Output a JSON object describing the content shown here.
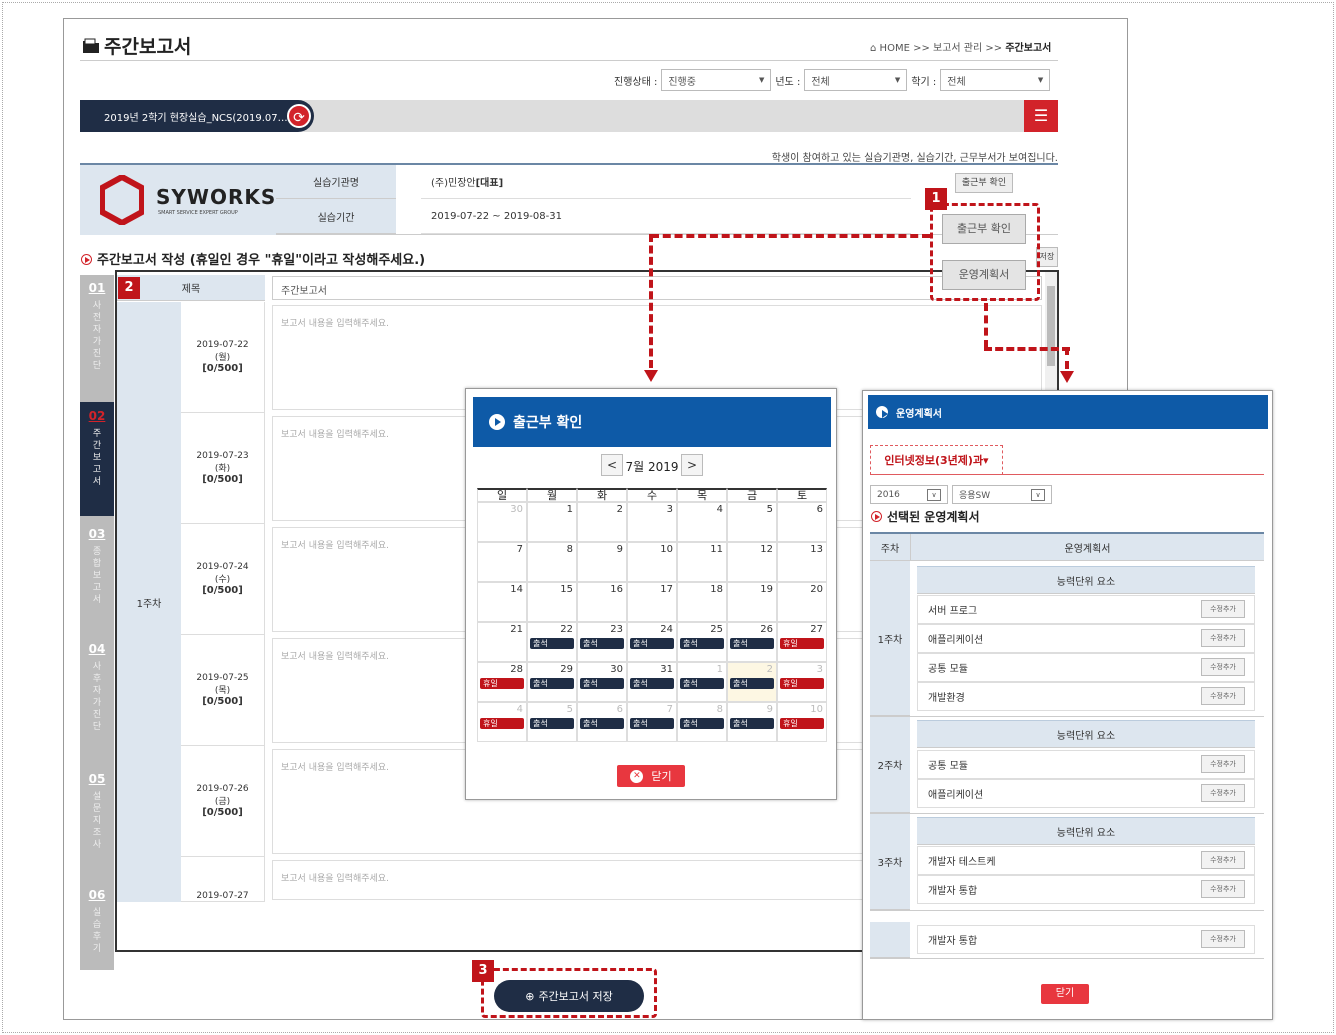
{
  "header": {
    "title": "주간보고서",
    "home": "HOME",
    "sep": ">>",
    "crumb_mid": "보고서 관리",
    "crumb_last": "주간보고서"
  },
  "filters": {
    "status_label": "진행상태 :",
    "status_value": "진행중",
    "year_label": "년도 :",
    "year_value": "전체",
    "term_label": "학기 :",
    "term_value": "전체",
    "arrow": "▼"
  },
  "course_bar": {
    "course": "2019년 2학기 현장실습_NCS(2019.07…",
    "refresh_icon": "⟳",
    "menu_icon": "☰"
  },
  "notice": "학생이 참여하고 있는 실습기관명, 실습기간, 근무부서가 보여집니다.",
  "company": {
    "logo_name": "SYWORKS",
    "logo_sub": "SMART SERVICE EXPERT GROUP",
    "org_label": "실습기관명",
    "org_value": "(주)민장안",
    "org_tag": "[대표]",
    "period_label": "실습기간",
    "period_value": "2019-07-22 ~ 2019-08-31",
    "attendance_small": "출근부 확인"
  },
  "section_title": "주간보고서 작성 (휴일인 경우 \"휴일\"이라고 작성해주세요.)",
  "save_partial": "저장",
  "side_nav": [
    {
      "num": "01",
      "label": "사전자가진단"
    },
    {
      "num": "02",
      "label": "주간보고서"
    },
    {
      "num": "03",
      "label": "종합보고서"
    },
    {
      "num": "04",
      "label": "사후자가진단"
    },
    {
      "num": "05",
      "label": "설문지조사"
    },
    {
      "num": "06",
      "label": "실습후기"
    }
  ],
  "form": {
    "subject_label": "제목",
    "subject_value": "주간보고서",
    "week_label": "1주차",
    "placeholder": "보고서 내용을 입력해주세요.",
    "days": [
      {
        "date": "2019-07-22",
        "dow": "(월)",
        "count": "[0/500]"
      },
      {
        "date": "2019-07-23",
        "dow": "(화)",
        "count": "[0/500]"
      },
      {
        "date": "2019-07-24",
        "dow": "(수)",
        "count": "[0/500]"
      },
      {
        "date": "2019-07-25",
        "dow": "(목)",
        "count": "[0/500]"
      },
      {
        "date": "2019-07-26",
        "dow": "(금)",
        "count": "[0/500]"
      },
      {
        "date": "2019-07-27",
        "dow": "",
        "count": ""
      }
    ]
  },
  "callouts": {
    "b1": "1",
    "b2": "2",
    "b3": "3",
    "attendance_btn": "출근부 확인",
    "plan_btn": "운영계획서"
  },
  "save_button": "주간보고서 저장",
  "attendance_popup": {
    "title": "출근부 확인",
    "month": "7월 2019",
    "prev": "<",
    "next": ">",
    "weekdays": [
      "일",
      "월",
      "화",
      "수",
      "목",
      "금",
      "토"
    ],
    "att": "출석",
    "off": "휴일",
    "weeks": [
      [
        [
          "30",
          "m",
          ""
        ],
        [
          "1",
          "",
          ""
        ],
        [
          "2",
          "",
          ""
        ],
        [
          "3",
          "",
          ""
        ],
        [
          "4",
          "",
          ""
        ],
        [
          "5",
          "",
          ""
        ],
        [
          "6",
          "",
          ""
        ]
      ],
      [
        [
          "7",
          "",
          ""
        ],
        [
          "8",
          "",
          ""
        ],
        [
          "9",
          "",
          ""
        ],
        [
          "10",
          "",
          ""
        ],
        [
          "11",
          "",
          ""
        ],
        [
          "12",
          "",
          ""
        ],
        [
          "13",
          "",
          ""
        ]
      ],
      [
        [
          "14",
          "",
          ""
        ],
        [
          "15",
          "",
          ""
        ],
        [
          "16",
          "",
          ""
        ],
        [
          "17",
          "",
          ""
        ],
        [
          "18",
          "",
          ""
        ],
        [
          "19",
          "",
          ""
        ],
        [
          "20",
          "",
          ""
        ]
      ],
      [
        [
          "21",
          "",
          ""
        ],
        [
          "22",
          "",
          "a"
        ],
        [
          "23",
          "",
          "a"
        ],
        [
          "24",
          "",
          "a"
        ],
        [
          "25",
          "",
          "a"
        ],
        [
          "26",
          "",
          "a"
        ],
        [
          "27",
          "",
          "o"
        ]
      ],
      [
        [
          "28",
          "",
          "o"
        ],
        [
          "29",
          "",
          "a"
        ],
        [
          "30",
          "",
          "a"
        ],
        [
          "31",
          "",
          "a"
        ],
        [
          "1",
          "m",
          "a"
        ],
        [
          "2",
          "t",
          "a"
        ],
        [
          "3",
          "m",
          "o"
        ]
      ],
      [
        [
          "4",
          "m",
          "o"
        ],
        [
          "5",
          "m",
          "a"
        ],
        [
          "6",
          "m",
          "a"
        ],
        [
          "7",
          "m",
          "a"
        ],
        [
          "8",
          "m",
          "a"
        ],
        [
          "9",
          "m",
          "a"
        ],
        [
          "10",
          "m",
          "o"
        ]
      ]
    ],
    "close": "닫기"
  },
  "plan_popup": {
    "title": "운영계획서",
    "dept_tab": "인터넷정보(3년제)과▾",
    "year": "2016",
    "subject": "응용SW",
    "selected_title": "선택된 운영계획서",
    "col_week": "주차",
    "col_plan": "운영계획서",
    "group_header": "능력단위 요소",
    "edit": "수정추가",
    "groups": [
      {
        "week": "1주차",
        "items": [
          "서버 프로그",
          "애플리케이션",
          "공통 모듈",
          "개발환경"
        ]
      },
      {
        "week": "2주차",
        "items": [
          "공통 모듈",
          "애플리케이션"
        ]
      },
      {
        "week": "3주차",
        "items": [
          "개발자 테스트케",
          "개발자 통합"
        ]
      }
    ],
    "extra_item": "개발자 통합",
    "close": "닫기"
  }
}
